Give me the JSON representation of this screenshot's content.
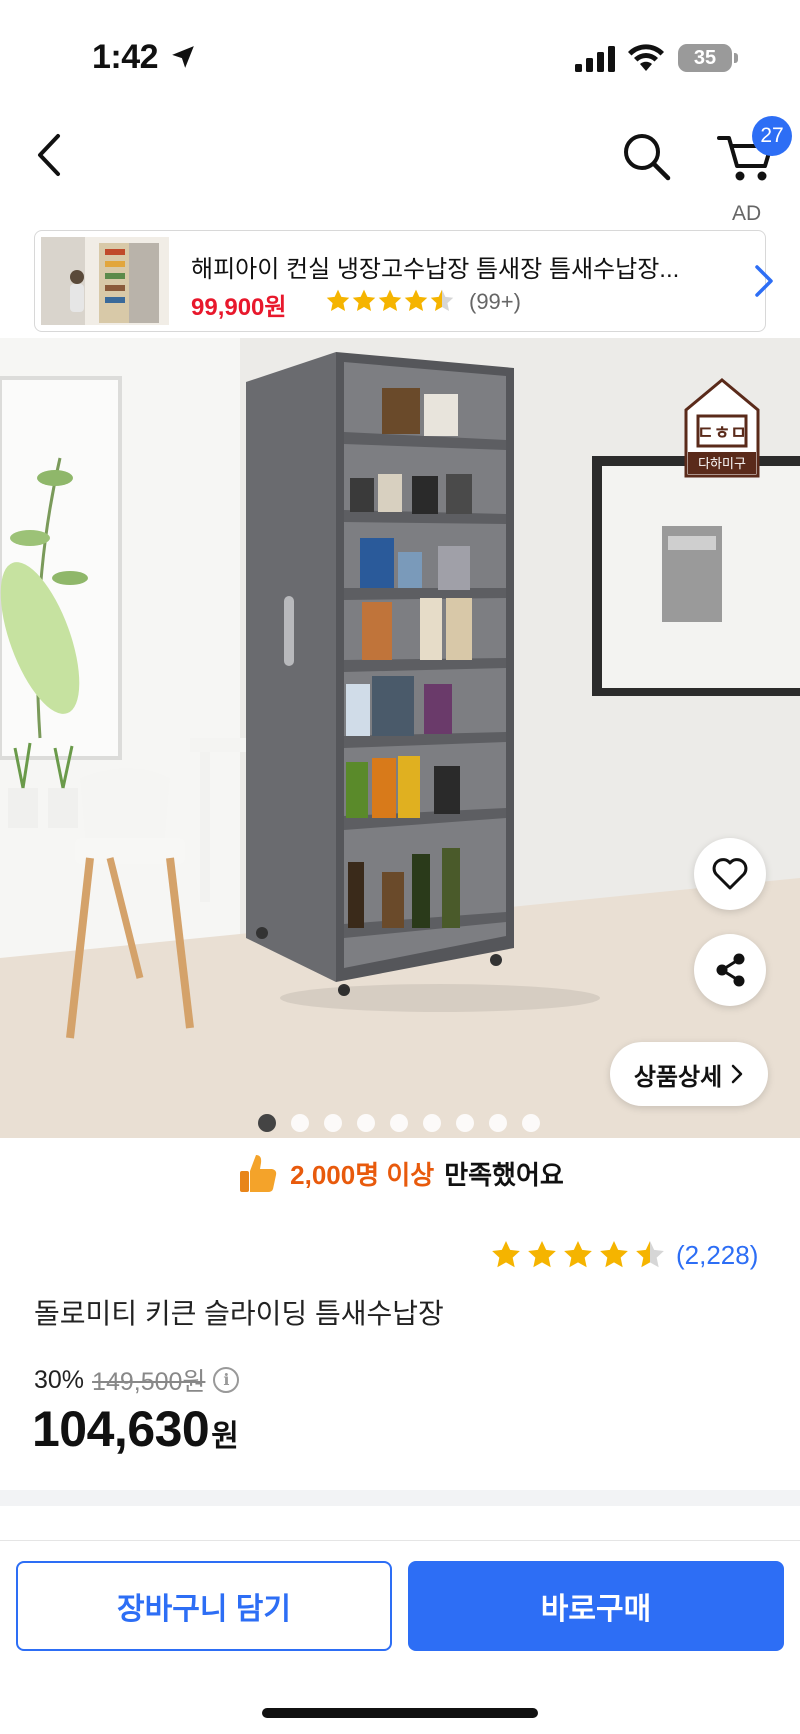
{
  "status_bar": {
    "time": "1:42",
    "battery": "35",
    "icons": [
      "location-arrow-icon",
      "cellular-signal-icon",
      "wifi-icon",
      "battery-icon"
    ]
  },
  "nav": {
    "icons": [
      "back-chevron-icon",
      "search-icon",
      "cart-icon"
    ],
    "cart_badge": "27",
    "ad_label": "AD"
  },
  "ad_card": {
    "title": "해피아이 컨실 냉장고수납장 틈새장 틈새수납장...",
    "price": "99,900원",
    "rating": 4.5,
    "reviews": "(99+)"
  },
  "hero": {
    "brand_logo_text": "다하미구",
    "detail_button": "상품상세",
    "dot_count": 9,
    "active_dot": 0,
    "icons": [
      "heart-icon",
      "share-icon",
      "chevron-right-icon"
    ]
  },
  "satisfaction": {
    "icon": "thumbs-up-icon",
    "count": "2,000명 이상",
    "text": "만족했어요"
  },
  "product": {
    "rating": 4.5,
    "rating_count": "(2,228)",
    "title": "돌로미티 키큰 슬라이딩 틈새수납장",
    "discount_rate": "30%",
    "original_price": "149,500원",
    "final_price": "104,630",
    "currency": "원"
  },
  "bottom": {
    "cart_button": "장바구니 담기",
    "buy_button": "바로구매"
  },
  "colors": {
    "accent_blue": "#2d6ef5",
    "price_red": "#e8182c",
    "star_yellow": "#f5b400",
    "highlight_orange": "#e85a0c"
  }
}
